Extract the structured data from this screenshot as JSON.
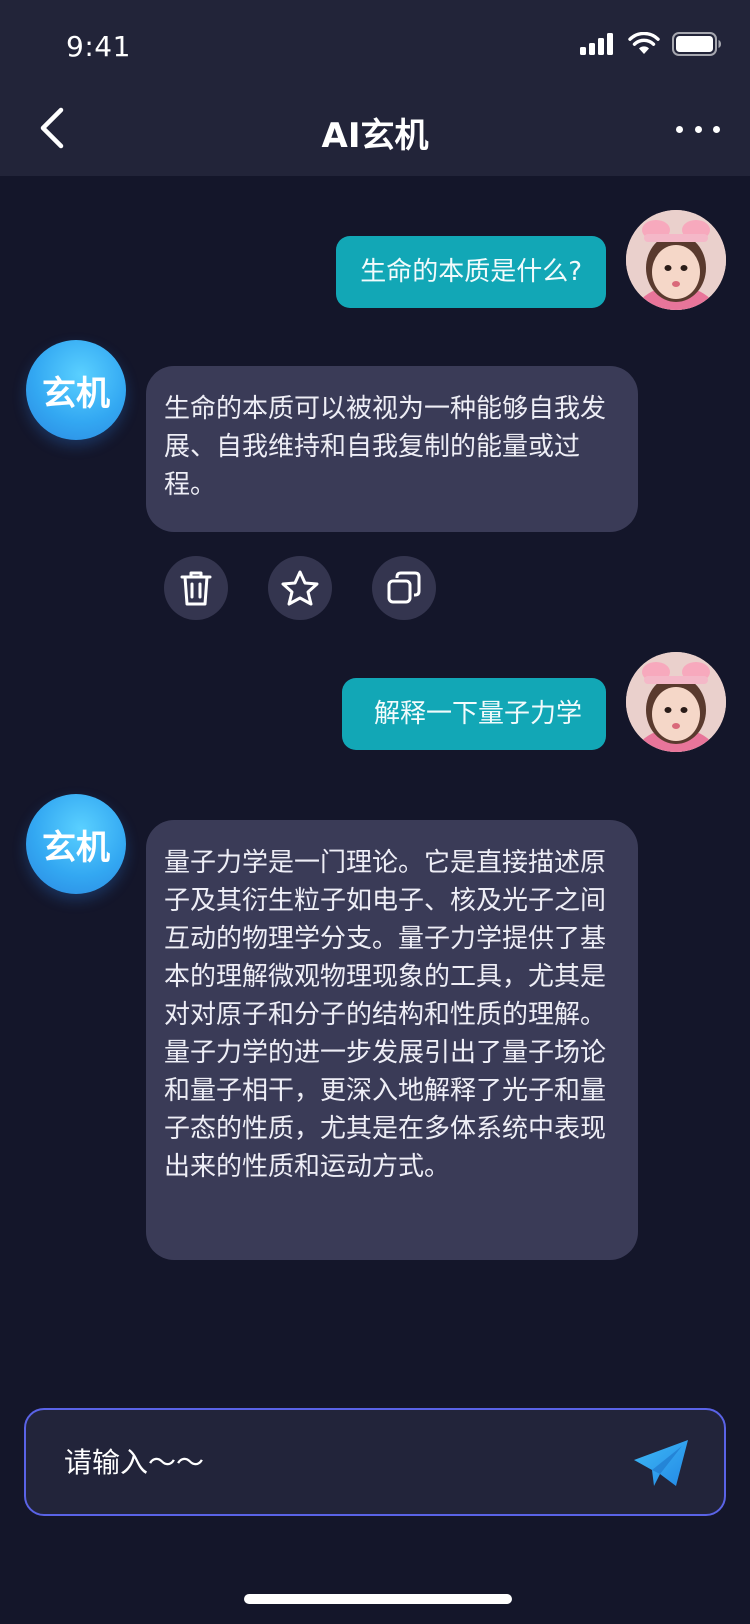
{
  "status_bar": {
    "time": "9:41"
  },
  "header": {
    "title": "AI玄机",
    "back_icon": "chevron-left-icon",
    "more_icon": "more-dots-icon"
  },
  "messages": {
    "user_1": "生命的本质是什么?",
    "ai_1": " 生命的本质可以被视为一种能够自我发展、自我维持和自我复制的能量或过程。",
    "user_2": " 解释一下量子力学",
    "ai_2": "量子力学是一门理论。它是直接描述原子及其衍生粒子如电子、核及光子之间互动的物理学分支。量子力学提供了基本的理解微观物理现象的工具，尤其是对对原子和分子的结构和性质的理解。量子力学的进一步发展引出了量子场论和量子相干，更深入地解释了光子和量子态的性质，尤其是在多体系统中表现出来的性质和运动方式。"
  },
  "ai_name": "玄机",
  "actions": [
    {
      "icon": "trash-icon"
    },
    {
      "icon": "star-icon"
    },
    {
      "icon": "copy-icon"
    }
  ],
  "composer": {
    "placeholder": "请输入～～",
    "value": "",
    "send_icon": "send-icon"
  },
  "colors": {
    "background": "#14162a",
    "header": "#222439",
    "user_bubble": "#12a7b6",
    "ai_bubble": "#3a3b57",
    "accent_blue": "#33a8f2",
    "input_border": "#5a63e6"
  }
}
